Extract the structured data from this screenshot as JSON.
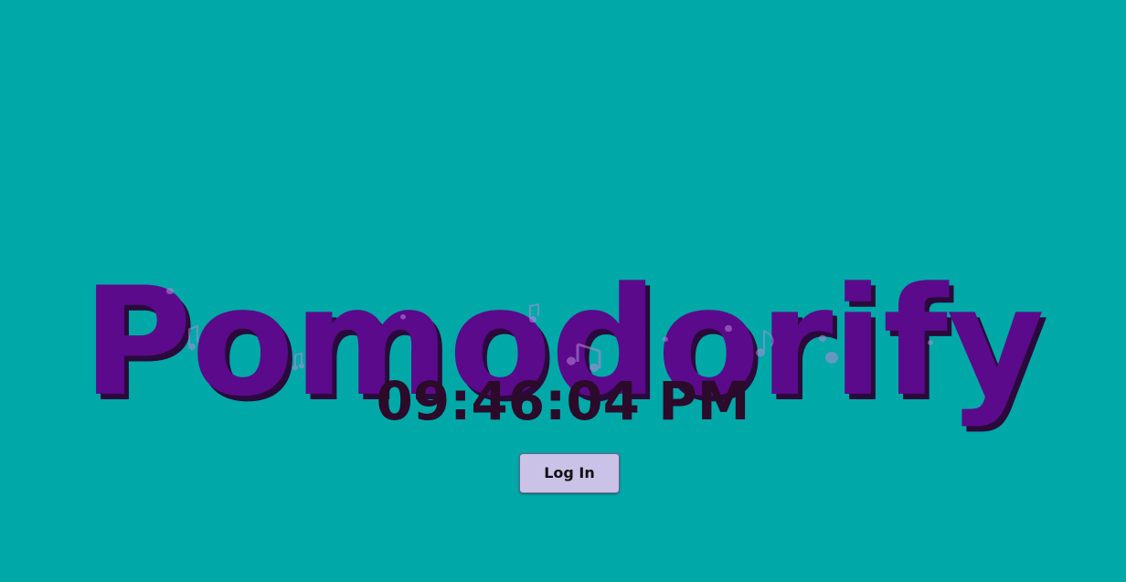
{
  "app": {
    "title": "Pomodorify",
    "brand_color": "#5a0a8a",
    "background_color": "#00a8a8"
  },
  "clock": {
    "time": "09:46:04 PM"
  },
  "auth": {
    "login_label": "Log In"
  },
  "decor": {
    "music_note_icon": "music-note-icon"
  }
}
